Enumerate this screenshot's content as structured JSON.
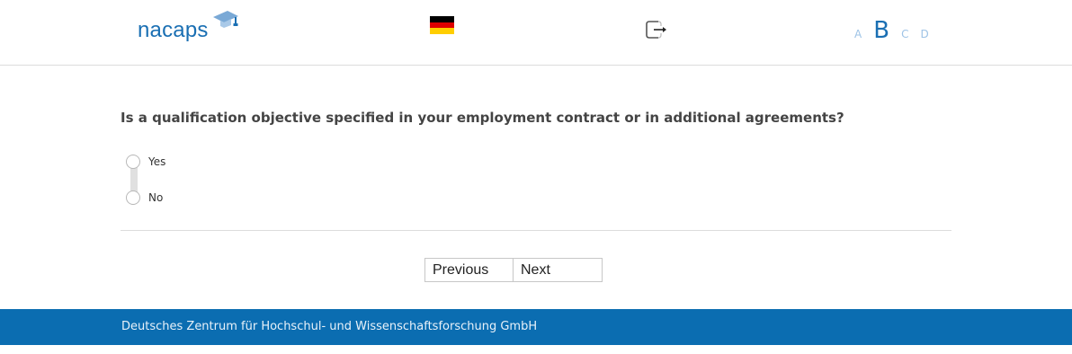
{
  "header": {
    "logo_text": "nacaps",
    "language_flag": "german-flag-icon",
    "exit_icon": "exit-icon",
    "font_sizes": [
      "A",
      "B",
      "C",
      "D"
    ],
    "font_size_active": "B"
  },
  "question": {
    "text": "Is a qualification objective specified in your employment contract or in additional agreements?",
    "options": [
      "Yes",
      "No"
    ]
  },
  "navigation": {
    "previous_label": "Previous",
    "next_label": "Next"
  },
  "footer": {
    "text": "Deutsches Zentrum für Hochschul- und Wissenschaftsforschung GmbH"
  },
  "colors": {
    "brand": "#1a6fb3",
    "footer_bg": "#0b6db1",
    "font_size_inactive": "#9ec3e6"
  }
}
